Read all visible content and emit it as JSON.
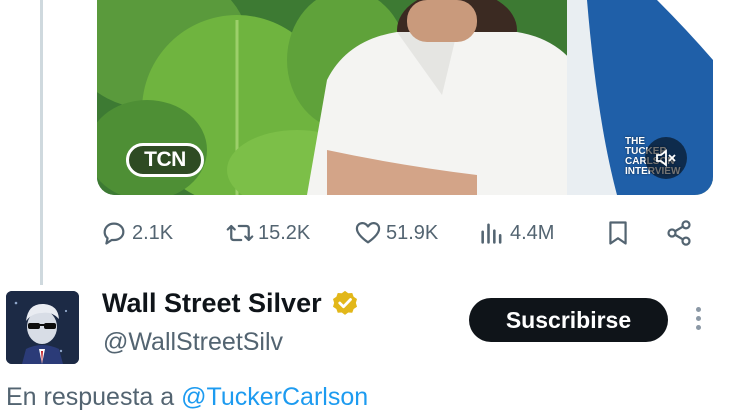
{
  "media": {
    "logo_text": "TCN",
    "watermark_lines": [
      "THE",
      "TUCKER",
      "CARLSON",
      "INTERVIEW"
    ]
  },
  "actions": {
    "replies": "2.1K",
    "reposts": "15.2K",
    "likes": "51.9K",
    "views": "4.4M"
  },
  "author": {
    "name": "Wall Street Silver",
    "handle": "@WallStreetSilv",
    "verified_color": "#e2b719"
  },
  "subscribe_label": "Suscribirse",
  "reply_context": {
    "prefix": "En respuesta a",
    "mention": "@TuckerCarlson"
  },
  "colors": {
    "text_secondary": "#536471",
    "link": "#1d9bf0",
    "button_bg": "#0f1419"
  }
}
